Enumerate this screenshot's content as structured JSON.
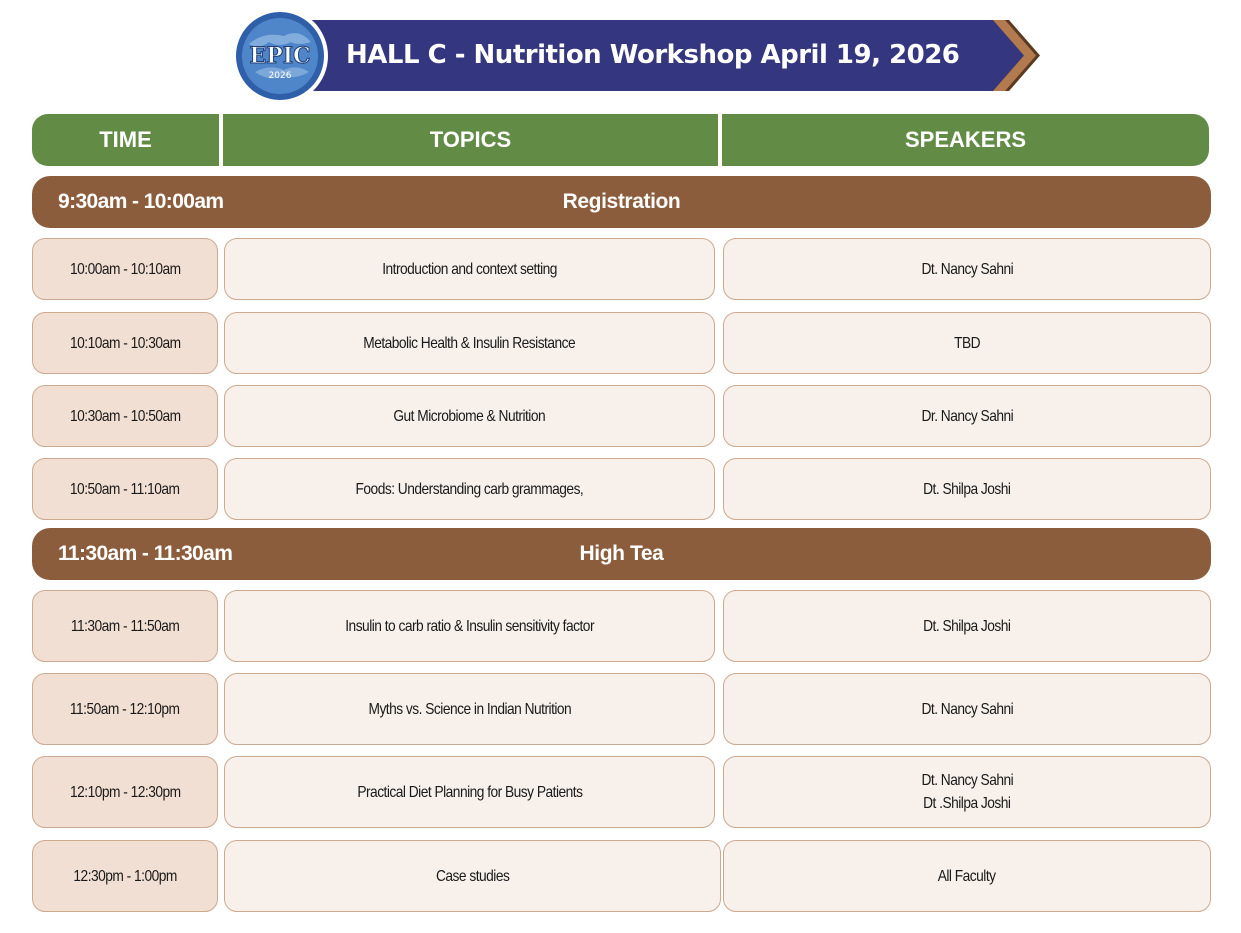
{
  "banner": {
    "title": "HALL C - Nutrition Workshop April 19, 2026",
    "logo_text": "EPIC",
    "logo_year": "2026",
    "colors": {
      "banner": "#34377f",
      "arrow_outer": "#5b3a22",
      "arrow_inner": "#b27a4e"
    }
  },
  "headers": {
    "time": "TIME",
    "topics": "TOPICS",
    "speakers": "SPEAKERS"
  },
  "breaks": [
    {
      "time": "9:30am - 10:00am",
      "title": "Registration"
    },
    {
      "time": "11:30am - 11:30am",
      "title": "High Tea"
    }
  ],
  "sessions": [
    {
      "time": "10:00am - 10:10am",
      "topic": "Introduction and context setting",
      "speakers": [
        "Dt. Nancy Sahni"
      ]
    },
    {
      "time": "10:10am - 10:30am",
      "topic": "Metabolic Health & Insulin Resistance",
      "speakers": [
        "TBD"
      ]
    },
    {
      "time": "10:30am - 10:50am",
      "topic": "Gut Microbiome & Nutrition",
      "speakers": [
        "Dr. Nancy Sahni"
      ]
    },
    {
      "time": "10:50am - 11:10am",
      "topic": "Foods: Understanding carb grammages,",
      "speakers": [
        "Dt. Shilpa Joshi"
      ]
    },
    {
      "time": "11:30am - 11:50am",
      "topic": "Insulin to carb ratio & Insulin sensitivity factor",
      "speakers": [
        "Dt. Shilpa Joshi"
      ]
    },
    {
      "time": "11:50am - 12:10pm",
      "topic": "Myths vs. Science in Indian Nutrition",
      "speakers": [
        "Dt. Nancy Sahni"
      ]
    },
    {
      "time": "12:10pm - 12:30pm",
      "topic": "Practical Diet Planning for Busy Patients",
      "speakers": [
        "Dt. Nancy Sahni",
        "Dt .Shilpa Joshi"
      ]
    },
    {
      "time": "12:30pm - 1:00pm",
      "topic": "Case studies",
      "speakers": [
        "All Faculty"
      ]
    }
  ],
  "theme": {
    "header_green": "#628c46",
    "break_brown": "#8b5d3c",
    "time_cell": "#f2dfd3",
    "content_cell": "#f8f1eb",
    "cell_border": "#cda98f"
  }
}
